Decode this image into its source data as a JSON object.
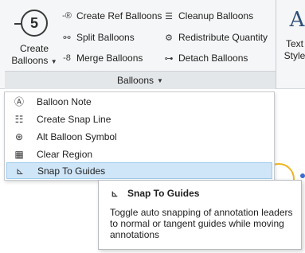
{
  "ribbon": {
    "group_title": "Balloons",
    "create_balloons": {
      "label_line1": "Create",
      "label_line2": "Balloons",
      "icon_number": "5"
    },
    "col1": [
      "Create Ref Balloons",
      "Split Balloons",
      "Merge Balloons"
    ],
    "col2": [
      "Cleanup Balloons",
      "Redistribute Quantity",
      "Detach Balloons"
    ],
    "text_style": {
      "glyph": "A",
      "label_line1": "Text",
      "label_line2": "Style"
    }
  },
  "menu": {
    "items": [
      {
        "label": "Balloon Note",
        "icon": "balloon-note-icon"
      },
      {
        "label": "Create Snap Line",
        "icon": "snap-line-icon"
      },
      {
        "label": "Alt Balloon Symbol",
        "icon": "alt-balloon-symbol-icon"
      },
      {
        "label": "Clear Region",
        "icon": "clear-region-icon"
      },
      {
        "label": "Snap To Guides",
        "icon": "snap-to-guides-icon",
        "active": true
      }
    ]
  },
  "tooltip": {
    "title": "Snap To Guides",
    "description": "Toggle auto snapping of annotation leaders to normal or tangent guides while moving annotations"
  },
  "colors": {
    "ribbon_bg": "#f5f6f7",
    "active_item": "#cfe6f8",
    "accent_blue": "#2d4f7a"
  }
}
